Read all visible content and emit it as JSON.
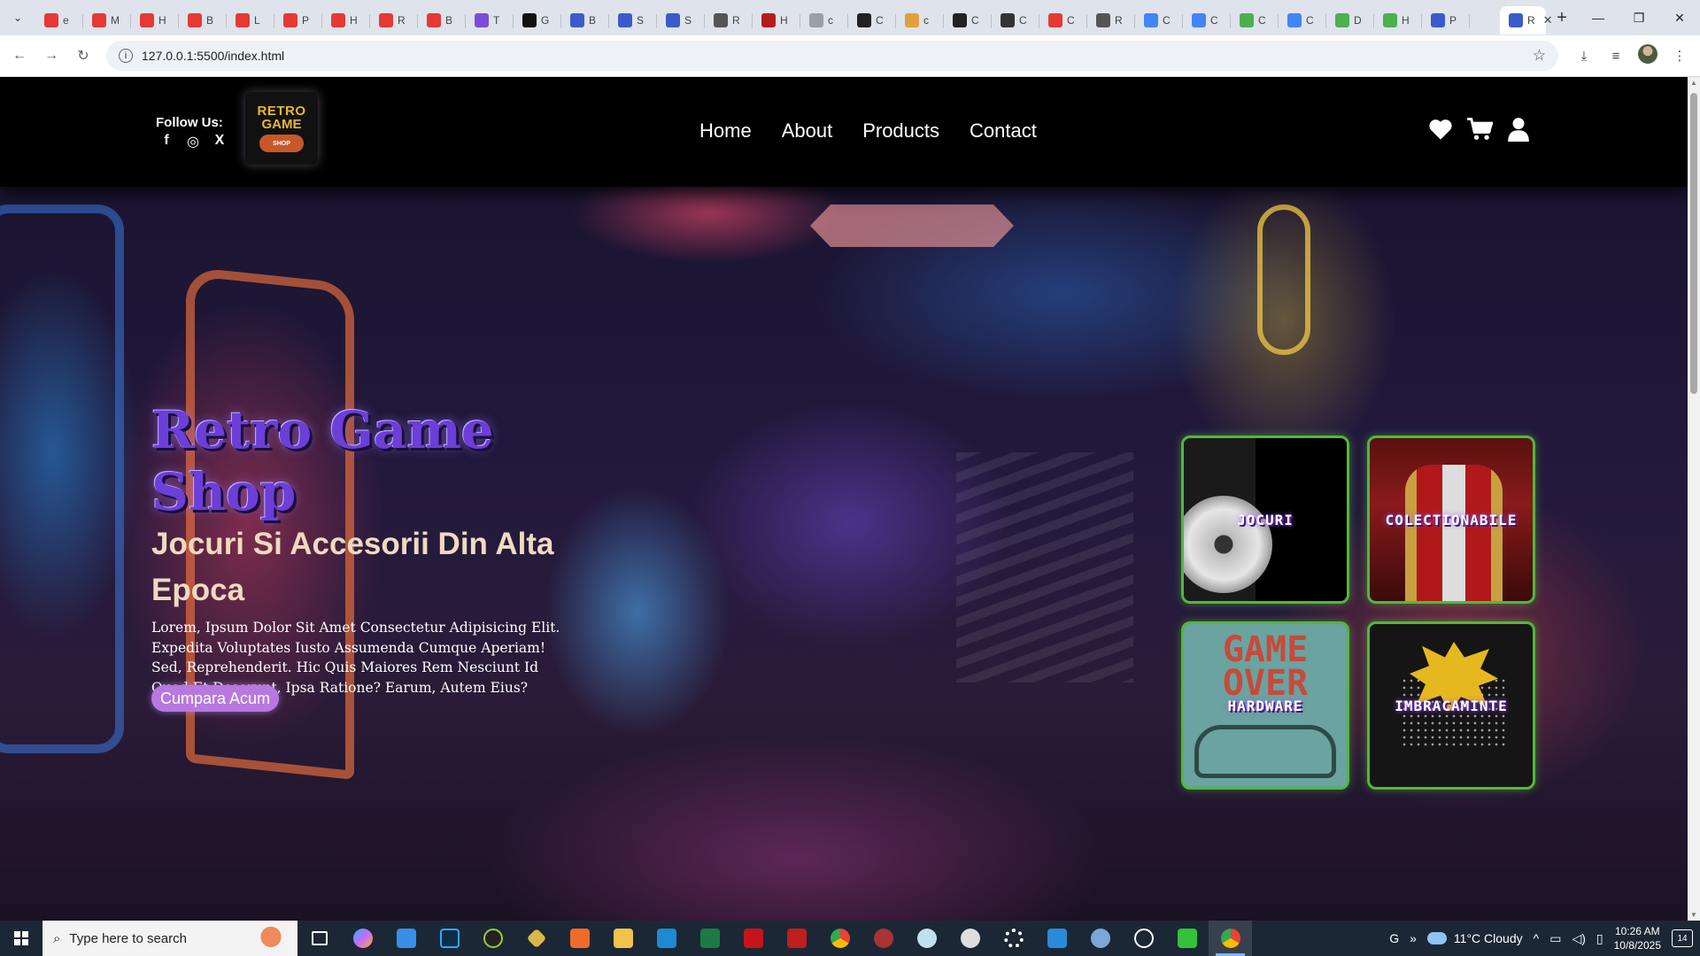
{
  "browser": {
    "tabs": [
      {
        "label": "e",
        "color": "#e53935"
      },
      {
        "label": "M",
        "color": "#e53935"
      },
      {
        "label": "H",
        "color": "#e53935"
      },
      {
        "label": "B",
        "color": "#e53935"
      },
      {
        "label": "L",
        "color": "#e53935"
      },
      {
        "label": "P",
        "color": "#e53935"
      },
      {
        "label": "H",
        "color": "#e53935"
      },
      {
        "label": "R",
        "color": "#e53935"
      },
      {
        "label": "B",
        "color": "#e53935"
      },
      {
        "label": "T",
        "color": "#7a4dd8"
      },
      {
        "label": "G",
        "color": "#111111"
      },
      {
        "label": "B",
        "color": "#3b5bcc"
      },
      {
        "label": "S",
        "color": "#3b5bcc"
      },
      {
        "label": "S",
        "color": "#3b5bcc"
      },
      {
        "label": "R",
        "color": "#555555"
      },
      {
        "label": "H",
        "color": "#b71c1c"
      },
      {
        "label": "c",
        "color": "#9aa0a6"
      },
      {
        "label": "C",
        "color": "#222222"
      },
      {
        "label": "c",
        "color": "#e0a040"
      },
      {
        "label": "C",
        "color": "#222222"
      },
      {
        "label": "C",
        "color": "#333333"
      },
      {
        "label": "C",
        "color": "#e53935"
      },
      {
        "label": "R",
        "color": "#555555"
      },
      {
        "label": "C",
        "color": "#4285f4"
      },
      {
        "label": "C",
        "color": "#4285f4"
      },
      {
        "label": "C",
        "color": "#4caf50"
      },
      {
        "label": "C",
        "color": "#4285f4"
      },
      {
        "label": "D",
        "color": "#4caf50"
      },
      {
        "label": "H",
        "color": "#4caf50"
      },
      {
        "label": "P",
        "color": "#3b5bcc"
      }
    ],
    "active_tab": {
      "label": "R",
      "close": "✕"
    },
    "url": "127.0.0.1:5500/index.html"
  },
  "site": {
    "follow_label": "Follow Us:",
    "socials": [
      "f",
      "◎",
      "X"
    ],
    "logo": {
      "line1": "RETRO",
      "line2": "GAME",
      "line3": "SHOP"
    },
    "nav": [
      "Home",
      "About",
      "Products",
      "Contact"
    ],
    "header_icons": [
      "heart-icon",
      "cart-icon",
      "user-icon"
    ]
  },
  "hero": {
    "title": "Retro Game Shop",
    "subtitle": "Jocuri Si Accesorii Din Alta Epoca",
    "text": "Lorem, Ipsum Dolor Sit Amet Consectetur Adipisicing Elit. Expedita Voluptates Iusto Assumenda Cumque Aperiam! Sed, Reprehenderit. Hic Quis Maiores Rem Nesciunt Id Quod Et Deserunt, Ipsa Ratione? Earum, Autem Eius?",
    "button": "Cumpara Acum",
    "categories": [
      "JOCURI",
      "COLECTIONABILE",
      "HARDWARE",
      "IMBRACAMINTE"
    ],
    "game_over_art": "GAME OVER",
    "accent_color": "#52b83a"
  },
  "taskbar": {
    "search_placeholder": "Type here to search",
    "weather": "11°C  Cloudy",
    "time": "10:26 AM",
    "date": "10/8/2025",
    "notifications": "14",
    "lang_indicator": "G"
  }
}
